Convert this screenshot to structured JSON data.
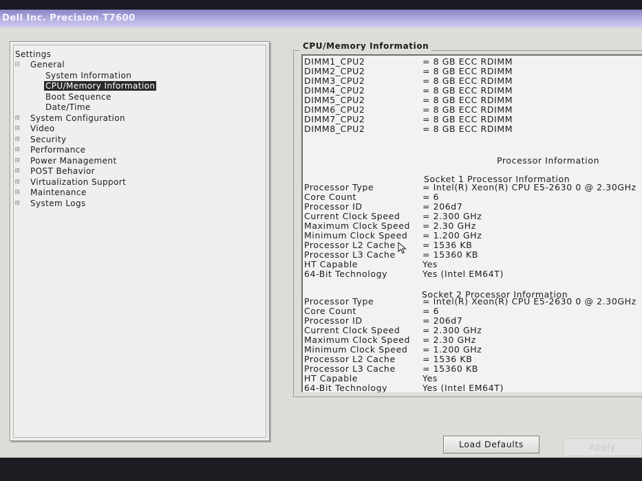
{
  "window": {
    "title": "Dell Inc. Precision T7600"
  },
  "tree": {
    "root": "Settings",
    "items": [
      {
        "label": "General",
        "sign": "⊟"
      },
      {
        "label": "System Information"
      },
      {
        "label": "CPU/Memory Information",
        "selected": true
      },
      {
        "label": "Boot Sequence"
      },
      {
        "label": "Date/Time"
      },
      {
        "label": "System Configuration",
        "sign": "⊞"
      },
      {
        "label": "Video",
        "sign": "⊞"
      },
      {
        "label": "Security",
        "sign": "⊞"
      },
      {
        "label": "Performance",
        "sign": "⊞"
      },
      {
        "label": "Power Management",
        "sign": "⊞"
      },
      {
        "label": "POST Behavior",
        "sign": "⊞"
      },
      {
        "label": "Virtualization Support",
        "sign": "⊞"
      },
      {
        "label": "Maintenance",
        "sign": "⊞"
      },
      {
        "label": "System Logs",
        "sign": "⊞"
      }
    ]
  },
  "info": {
    "group_title": "CPU/Memory Information",
    "dimms": [
      {
        "label": "DIMM1_CPU2",
        "value": "= 8 GB ECC RDIMM"
      },
      {
        "label": "DIMM2_CPU2",
        "value": "= 8 GB ECC RDIMM"
      },
      {
        "label": "DIMM3_CPU2",
        "value": "= 8 GB ECC RDIMM"
      },
      {
        "label": "DIMM4_CPU2",
        "value": "= 8 GB ECC RDIMM"
      },
      {
        "label": "DIMM5_CPU2",
        "value": "= 8 GB ECC RDIMM"
      },
      {
        "label": "DIMM6_CPU2",
        "value": "= 8 GB ECC RDIMM"
      },
      {
        "label": "DIMM7_CPU2",
        "value": "= 8 GB ECC RDIMM"
      },
      {
        "label": "DIMM8_CPU2",
        "value": "= 8 GB ECC RDIMM"
      }
    ],
    "processor_heading": "Processor Information",
    "sockets": [
      {
        "title": "Socket 1 Processor Information",
        "rows": [
          {
            "label": "Processor Type",
            "value": "= Intel(R) Xeon(R) CPU E5-2630 0 @ 2.30GHz"
          },
          {
            "label": "Core Count",
            "value": "= 6"
          },
          {
            "label": "Processor ID",
            "value": "= 206d7"
          },
          {
            "label": "Current Clock Speed",
            "value": "= 2.300 GHz"
          },
          {
            "label": "Maximum Clock Speed",
            "value": "= 2.30 GHz"
          },
          {
            "label": "Minimum Clock Speed",
            "value": "= 1.200 GHz"
          },
          {
            "label": "Processor L2 Cache",
            "value": "= 1536 KB"
          },
          {
            "label": "Processor L3 Cache",
            "value": "= 15360 KB"
          },
          {
            "label": "HT Capable",
            "value": "Yes"
          },
          {
            "label": "64-Bit Technology",
            "value": "Yes (Intel EM64T)"
          }
        ]
      },
      {
        "title": "Socket 2 Processor Information",
        "rows": [
          {
            "label": "Processor Type",
            "value": "= Intel(R) Xeon(R) CPU E5-2630 0 @ 2.30GHz"
          },
          {
            "label": "Core Count",
            "value": "= 6"
          },
          {
            "label": "Processor ID",
            "value": "= 206d7"
          },
          {
            "label": "Current Clock Speed",
            "value": "= 2.300 GHz"
          },
          {
            "label": "Maximum Clock Speed",
            "value": "= 2.30 GHz"
          },
          {
            "label": "Minimum Clock Speed",
            "value": "= 1.200 GHz"
          },
          {
            "label": "Processor L2 Cache",
            "value": "= 1536 KB"
          },
          {
            "label": "Processor L3 Cache",
            "value": "= 15360 KB"
          },
          {
            "label": "HT Capable",
            "value": "Yes"
          },
          {
            "label": "64-Bit Technology",
            "value": "Yes (Intel EM64T)"
          }
        ]
      }
    ]
  },
  "buttons": {
    "load_defaults": "Load Defaults",
    "apply": "Apply"
  }
}
